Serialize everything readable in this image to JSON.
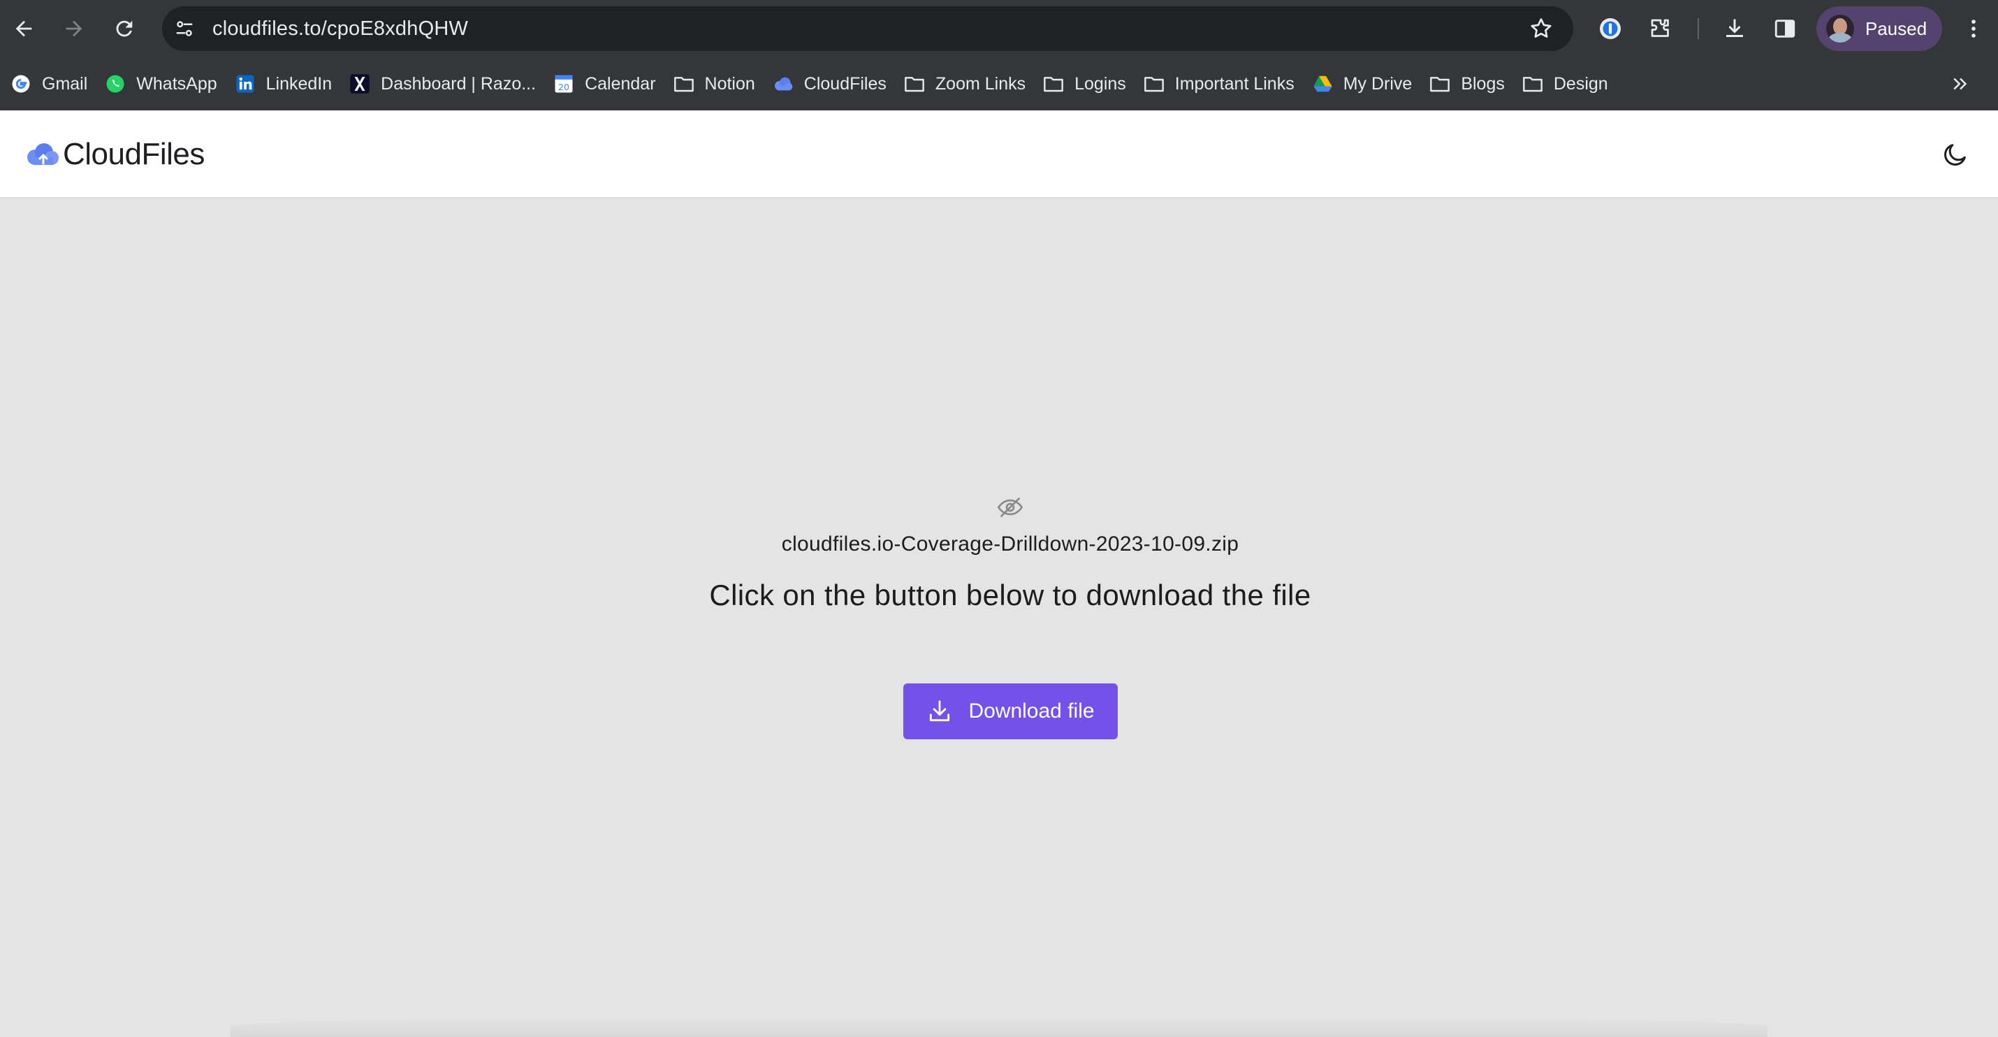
{
  "browser": {
    "url": "cloudfiles.to/cpoE8xdhQHW",
    "profile_label": "Paused",
    "icons": {
      "back": "back-arrow-icon",
      "forward": "forward-arrow-icon",
      "reload": "reload-icon",
      "site_settings": "tune-icon",
      "bookmark_star": "star-icon",
      "password_manager": "onepassword-icon",
      "extensions": "puzzle-icon",
      "downloads": "download-icon",
      "side_panel": "side-panel-icon",
      "menu": "kebab-menu-icon"
    }
  },
  "bookmarks": [
    {
      "label": "Gmail",
      "icon": "google-icon"
    },
    {
      "label": "WhatsApp",
      "icon": "whatsapp-icon"
    },
    {
      "label": "LinkedIn",
      "icon": "linkedin-icon"
    },
    {
      "label": "Dashboard | Razo...",
      "icon": "x-icon"
    },
    {
      "label": "Calendar",
      "icon": "calendar-icon"
    },
    {
      "label": "Notion",
      "icon": "folder-icon"
    },
    {
      "label": "CloudFiles",
      "icon": "cloud-icon"
    },
    {
      "label": "Zoom Links",
      "icon": "folder-icon"
    },
    {
      "label": "Logins",
      "icon": "folder-icon"
    },
    {
      "label": "Important Links",
      "icon": "folder-icon"
    },
    {
      "label": "My Drive",
      "icon": "google-drive-icon"
    },
    {
      "label": "Blogs",
      "icon": "folder-icon"
    },
    {
      "label": "Design",
      "icon": "folder-icon"
    }
  ],
  "app": {
    "brand": "CloudFiles",
    "file_name": "cloudfiles.io-Coverage-Drilldown-2023-10-09.zip",
    "instruction": "Click on the button below to download the file",
    "download_label": "Download file",
    "colors": {
      "accent": "#7452ea",
      "page_bg": "#e4e4e4",
      "header_bg": "#ffffff",
      "chrome_bg": "#35363a",
      "omnibox_bg": "#202124",
      "profile_bg": "#55436f"
    }
  }
}
